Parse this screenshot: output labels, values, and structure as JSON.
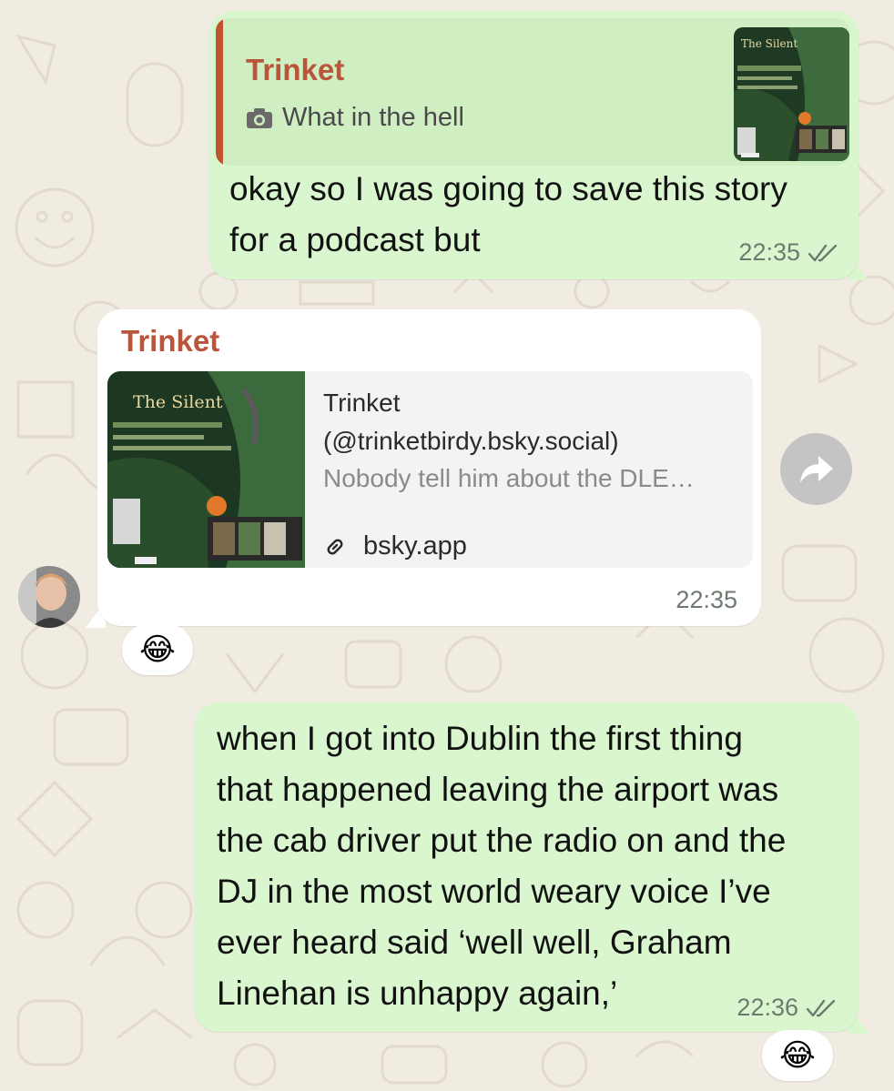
{
  "messages": [
    {
      "direction": "outgoing",
      "reply": {
        "author": "Trinket",
        "media_icon": "camera-icon",
        "text": "What in the hell",
        "thumb_title": "The Silent"
      },
      "text": "okay so I was going to save this story\nfor a podcast but",
      "time": "22:35",
      "status_icon": "double-check-icon"
    },
    {
      "direction": "incoming",
      "sender": "Trinket",
      "link_preview": {
        "thumb_title": "The Silent",
        "title": "Trinket\n(@trinketbirdy.bsky.social)",
        "description": "Nobody tell him about the DLE…",
        "domain": "bsky.app"
      },
      "time": "22:35",
      "reaction": "😂"
    },
    {
      "direction": "outgoing",
      "text": "when I got into Dublin the first thing\nthat happened leaving the airport was\nthe cab driver put the radio on and the\nDJ in the most world weary voice I’ve\never heard said ‘well well, Graham\nLinehan is unhappy again,’",
      "time": "22:36",
      "status_icon": "double-check-icon",
      "reaction": "😂"
    }
  ],
  "colors": {
    "background": "#f1ece2",
    "outgoing_bubble": "#d9f6cf",
    "incoming_bubble": "#ffffff",
    "sender_name": "#b8553a",
    "quote_bar": "#c0542f"
  }
}
